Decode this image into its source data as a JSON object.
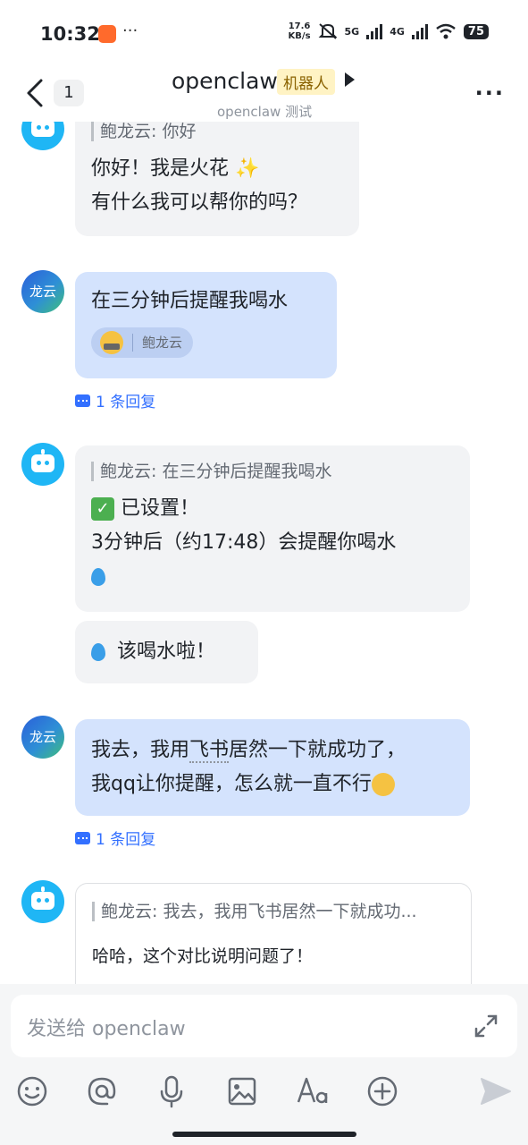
{
  "status_bar": {
    "time": "10:32",
    "more": "···",
    "net_speed_value": "17.6",
    "net_speed_unit": "KB/s",
    "sim1": "5G",
    "sim2": "4G",
    "battery": "75"
  },
  "header": {
    "unread_count": "1",
    "title": "openclaw",
    "tag": "机器人",
    "subtitle": "openclaw 测试",
    "more": "···"
  },
  "messages": {
    "m1": {
      "quote": "鲍龙云: 你好",
      "line1": "你好！我是火花",
      "emoji": "✨",
      "line2": "有什么我可以帮你的吗？"
    },
    "m2": {
      "avatar_text": "龙云",
      "text": "在三分钟后提醒我喝水",
      "reaction_name": "鲍龙云",
      "reply": "1 条回复"
    },
    "m3": {
      "quote": "鲍龙云: 在三分钟后提醒我喝水",
      "check": "✓",
      "line1": "已设置！",
      "line2": "3分钟后（约17:48）会提醒你喝水"
    },
    "m4": {
      "text": "该喝水啦！"
    },
    "m5": {
      "avatar_text": "龙云",
      "line1_a": "我去，我用",
      "line1_link": "飞书",
      "line1_b": "居然一下就成功了，",
      "line2": "我qq让你提醒，怎么就一直不行",
      "reply": "1 条回复"
    },
    "m6": {
      "quote": "鲍龙云: 我去，我用飞书居然一下就成功...",
      "text": "哈哈，这个对比说明问题了！"
    }
  },
  "composer": {
    "placeholder": "发送给 openclaw"
  },
  "colors": {
    "accent": "#3370ff",
    "bot_bubble": "#f2f3f5",
    "user_bubble": "#d4e3fd",
    "bot_avatar": "#1fb6f5",
    "tag_bg": "#fff3c4"
  },
  "icons": [
    "back-icon",
    "more-icon",
    "robot-avatar-icon",
    "reply-thread-icon",
    "expand-icon",
    "emoji-icon",
    "mention-icon",
    "microphone-icon",
    "image-icon",
    "text-format-icon",
    "add-icon",
    "send-icon"
  ]
}
